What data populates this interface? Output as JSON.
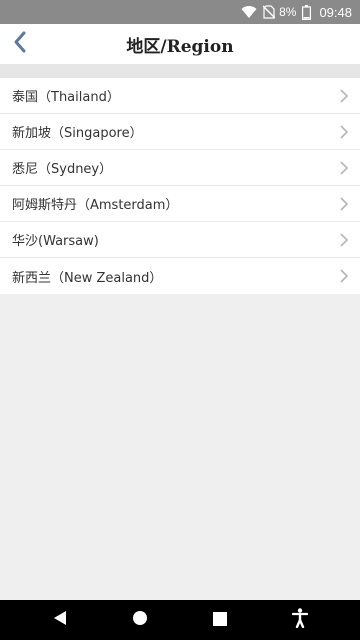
{
  "status_bar": {
    "battery_percent": "8%",
    "time": "09:48"
  },
  "header": {
    "title": "地区/Region"
  },
  "regions": [
    {
      "label": "泰国（Thailand）"
    },
    {
      "label": "新加坡（Singapore）"
    },
    {
      "label": "悉尼（Sydney）"
    },
    {
      "label": "阿姆斯特丹（Amsterdam）"
    },
    {
      "label": "华沙(Warsaw)"
    },
    {
      "label": "新西兰（New Zealand）"
    }
  ],
  "colors": {
    "status_bar_bg": "#8a8a8a",
    "accent_back_arrow": "#5c7a99",
    "nav_bar_bg": "#000000",
    "page_bg": "#efefef"
  },
  "icons": {
    "wifi": "wifi-icon",
    "no_sim": "no-sim-icon",
    "battery": "battery-icon",
    "back": "back-arrow-icon",
    "chevron": "chevron-right-icon",
    "nav_back": "nav-back-icon",
    "nav_home": "nav-home-icon",
    "nav_recents": "nav-recents-icon",
    "accessibility": "accessibility-icon"
  }
}
